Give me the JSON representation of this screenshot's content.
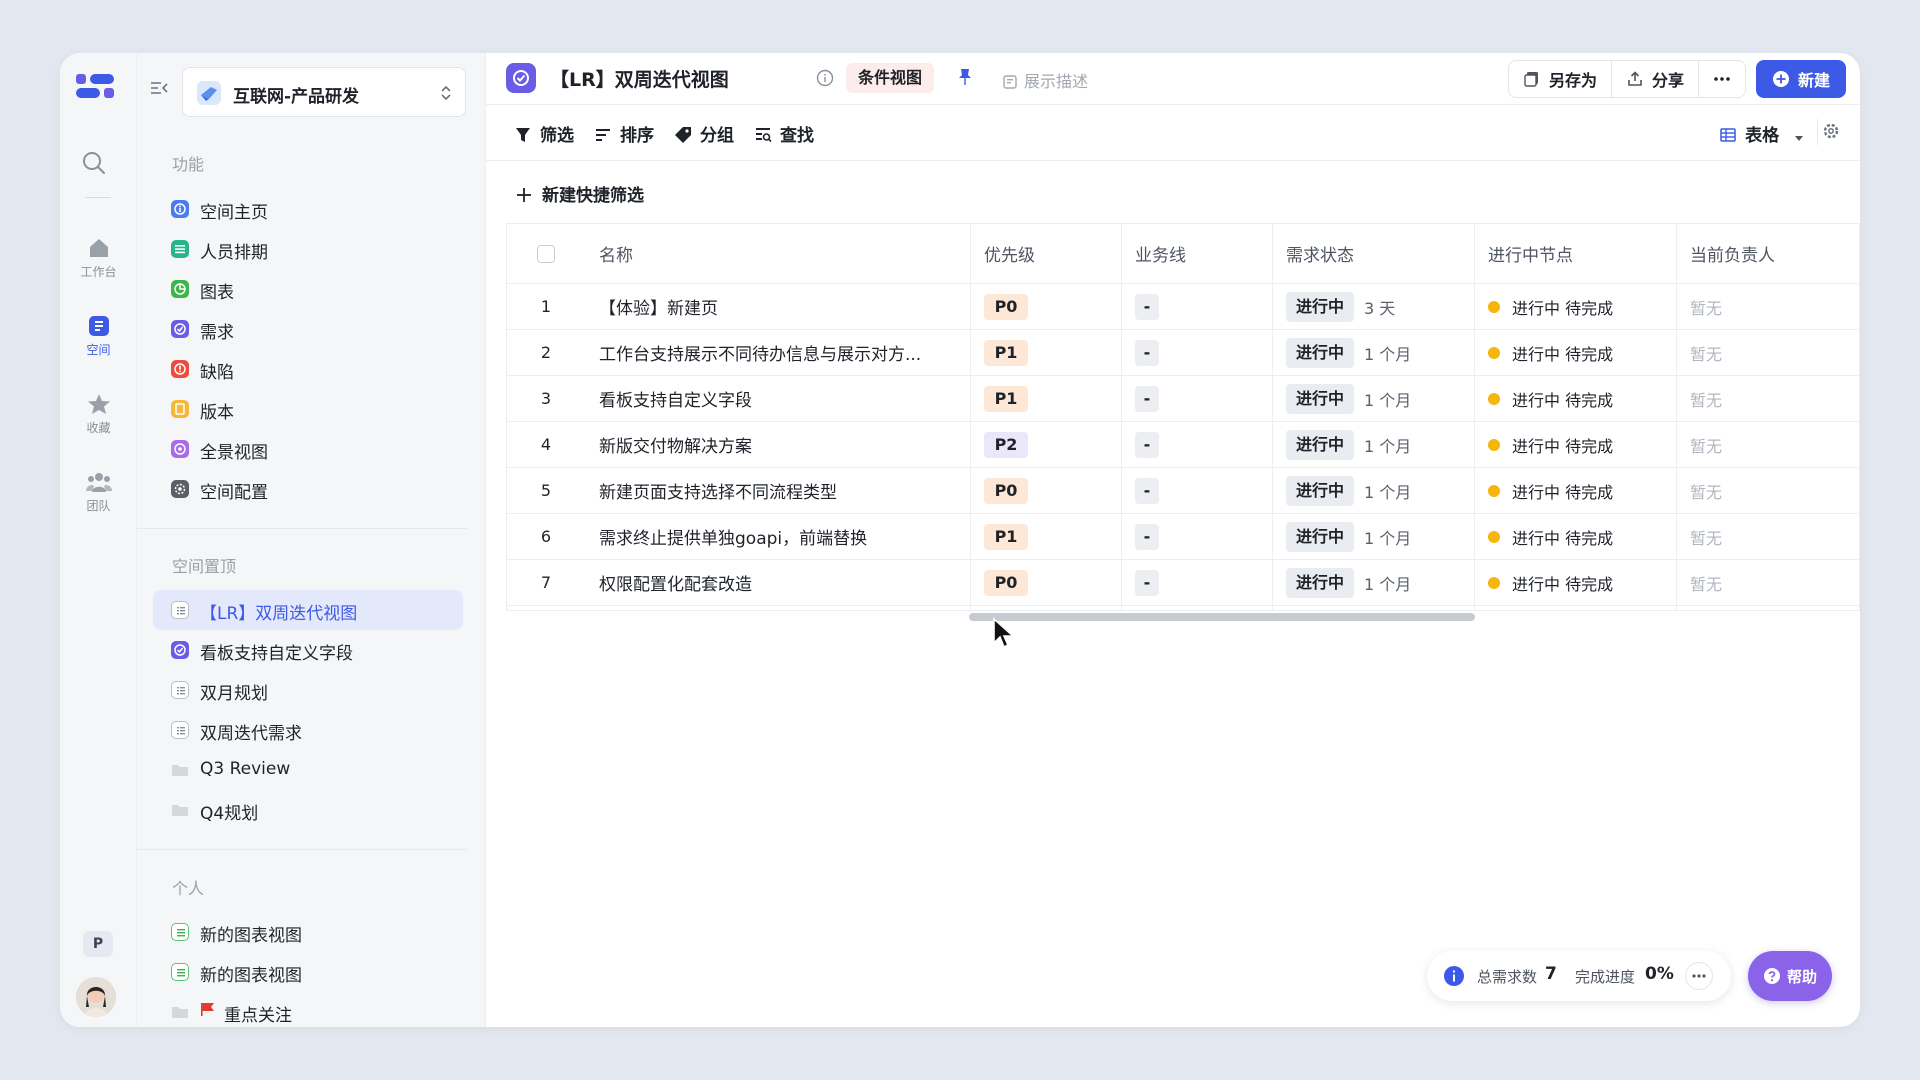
{
  "rail": {
    "items": [
      {
        "label": "工作台",
        "icon": "home-icon"
      },
      {
        "label": "空间",
        "icon": "space-icon"
      },
      {
        "label": "收藏",
        "icon": "star-icon"
      },
      {
        "label": "团队",
        "icon": "team-icon"
      }
    ],
    "user_initial": "P"
  },
  "sidebar": {
    "space_name": "互联网-产品研发",
    "section_features": "功能",
    "features": [
      {
        "label": "空间主页",
        "color": "#4b7bf0"
      },
      {
        "label": "人员排期",
        "color": "#27b58b"
      },
      {
        "label": "图表",
        "color": "#3cb54a"
      },
      {
        "label": "需求",
        "color": "#6b5ce7"
      },
      {
        "label": "缺陷",
        "color": "#ef4a3c"
      },
      {
        "label": "版本",
        "color": "#f6b73a"
      },
      {
        "label": "全景视图",
        "color": "#a86be9"
      },
      {
        "label": "空间配置",
        "color": "#5b5f66"
      }
    ],
    "section_pinned": "空间置顶",
    "pinned": [
      {
        "label": "【LR】双周迭代视图",
        "icon": "list-view-icon"
      },
      {
        "label": "看板支持自定义字段",
        "icon": "requirement-icon"
      },
      {
        "label": "双月规划",
        "icon": "list-view-icon"
      },
      {
        "label": "双周迭代需求",
        "icon": "list-view-icon"
      },
      {
        "label": "Q3 Review",
        "icon": "folder-icon"
      },
      {
        "label": "Q4规划",
        "icon": "folder-icon"
      }
    ],
    "section_personal": "个人",
    "personal": [
      {
        "label": "新的图表视图",
        "icon": "chart-view-icon"
      },
      {
        "label": "新的图表视图",
        "icon": "chart-view-icon"
      },
      {
        "label": "重点关注",
        "icon": "folder-flag-icon"
      }
    ]
  },
  "header": {
    "title": "【LR】双周迭代视图",
    "tag": "条件视图",
    "show_desc": "展示描述",
    "save_as": "另存为",
    "share": "分享",
    "new": "新建"
  },
  "toolbar": {
    "filter": "筛选",
    "sort": "排序",
    "group": "分组",
    "find": "查找",
    "view_mode": "表格"
  },
  "quick_filter": "新建快捷筛选",
  "table": {
    "columns": [
      "名称",
      "优先级",
      "业务线",
      "需求状态",
      "进行中节点",
      "当前负责人"
    ],
    "rows": [
      {
        "idx": "1",
        "name": "【体验】新建页",
        "priority": "P0",
        "biz": "-",
        "state": "进行中",
        "duration": "3 天",
        "node": "进行中 待完成",
        "owner": "暂无"
      },
      {
        "idx": "2",
        "name": "工作台支持展示不同待办信息与展示对方...",
        "priority": "P1",
        "biz": "-",
        "state": "进行中",
        "duration": "1 个月",
        "node": "进行中 待完成",
        "owner": "暂无"
      },
      {
        "idx": "3",
        "name": "看板支持自定义字段",
        "priority": "P1",
        "biz": "-",
        "state": "进行中",
        "duration": "1 个月",
        "node": "进行中 待完成",
        "owner": "暂无"
      },
      {
        "idx": "4",
        "name": "新版交付物解决方案",
        "priority": "P2",
        "biz": "-",
        "state": "进行中",
        "duration": "1 个月",
        "node": "进行中 待完成",
        "owner": "暂无"
      },
      {
        "idx": "5",
        "name": "新建页面支持选择不同流程类型",
        "priority": "P0",
        "biz": "-",
        "state": "进行中",
        "duration": "1 个月",
        "node": "进行中 待完成",
        "owner": "暂无"
      },
      {
        "idx": "6",
        "name": "需求终止提供单独goapi，前端替换",
        "priority": "P1",
        "biz": "-",
        "state": "进行中",
        "duration": "1 个月",
        "node": "进行中 待完成",
        "owner": "暂无"
      },
      {
        "idx": "7",
        "name": "权限配置化配套改造",
        "priority": "P0",
        "biz": "-",
        "state": "进行中",
        "duration": "1 个月",
        "node": "进行中 待完成",
        "owner": "暂无"
      }
    ]
  },
  "footer": {
    "total_label": "总需求数",
    "total_value": "7",
    "progress_label": "完成进度",
    "progress_value": "0%",
    "help": "帮助"
  },
  "colors": {
    "accent": "#3c5ae6",
    "help": "#8a63e8",
    "status_dot": "#f5b50b"
  }
}
